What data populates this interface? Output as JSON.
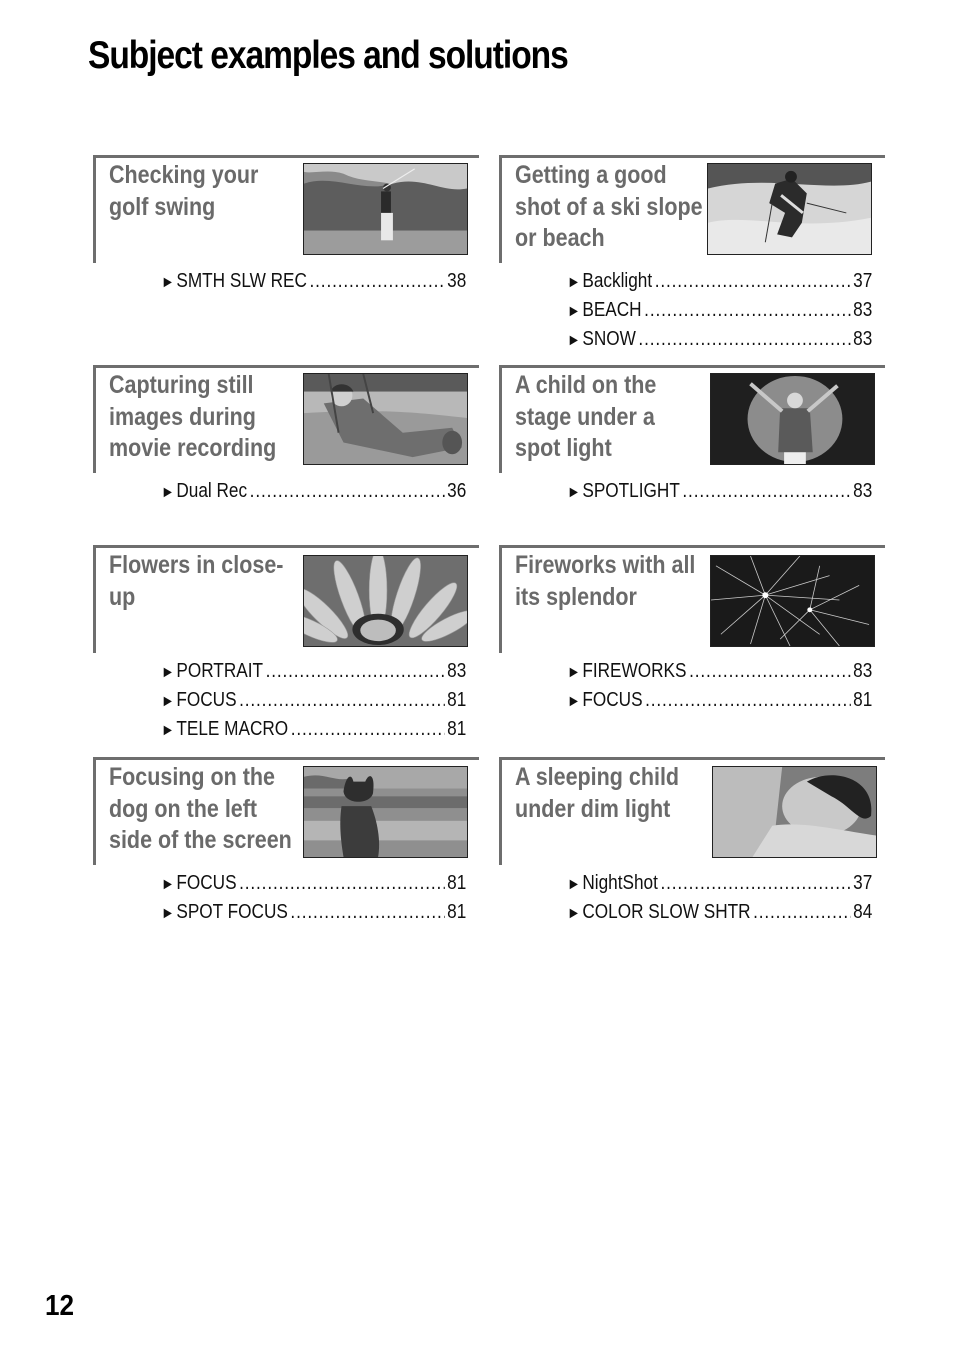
{
  "page": {
    "title": "Subject examples and solutions",
    "page_number": "12"
  },
  "cards": [
    {
      "title": "Checking your\ngolf swing",
      "photo": "golfer-swinging-photo",
      "refs": [
        {
          "label": "SMTH SLW REC",
          "page": "38"
        }
      ]
    },
    {
      "title": "Getting a good\nshot of a ski slope\nor beach",
      "photo": "skier-photo",
      "refs": [
        {
          "label": "Backlight",
          "page": "37"
        },
        {
          "label": "BEACH",
          "page": "83"
        },
        {
          "label": "SNOW",
          "page": "83"
        }
      ]
    },
    {
      "title": "Capturing still\nimages during\nmovie recording",
      "photo": "child-on-swing-photo",
      "refs": [
        {
          "label": "Dual Rec",
          "page": "36"
        }
      ]
    },
    {
      "title": "A child on the\nstage under a\nspot light",
      "photo": "child-on-stage-photo",
      "refs": [
        {
          "label": "SPOTLIGHT",
          "page": "83"
        }
      ]
    },
    {
      "title": "Flowers in close-\nup",
      "photo": "flower-closeup-photo",
      "refs": [
        {
          "label": "PORTRAIT",
          "page": "83"
        },
        {
          "label": "FOCUS",
          "page": "81"
        },
        {
          "label": "TELE MACRO",
          "page": "81"
        }
      ]
    },
    {
      "title": "Fireworks with all\nits splendor",
      "photo": "fireworks-photo",
      "refs": [
        {
          "label": "FIREWORKS",
          "page": "83"
        },
        {
          "label": "FOCUS",
          "page": "81"
        }
      ]
    },
    {
      "title": "Focusing on the\ndog on the left\nside of the screen",
      "photo": "dog-on-beach-photo",
      "refs": [
        {
          "label": "FOCUS",
          "page": "81"
        },
        {
          "label": "SPOT FOCUS",
          "page": "81"
        }
      ]
    },
    {
      "title": "A sleeping child\nunder dim light",
      "photo": "sleeping-child-photo",
      "refs": [
        {
          "label": "NightShot",
          "page": "37"
        },
        {
          "label": "COLOR SLOW SHTR",
          "page": "84"
        }
      ]
    }
  ],
  "arrow_glyph": "►"
}
